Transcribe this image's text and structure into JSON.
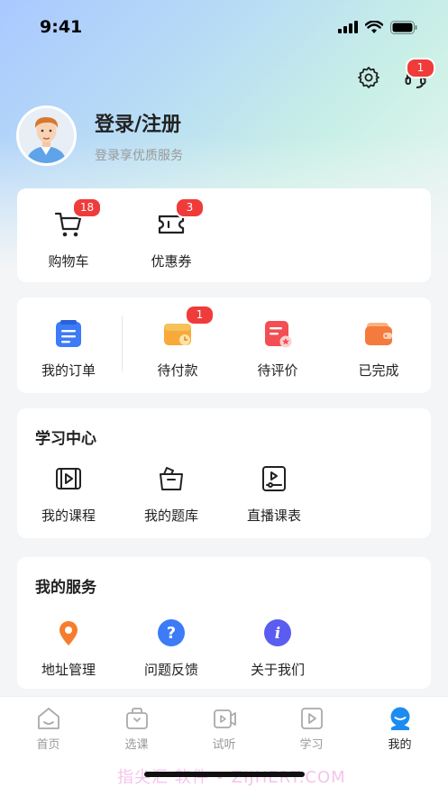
{
  "status_bar": {
    "time": "9:41"
  },
  "header": {
    "settings_icon": "gear-icon",
    "service_icon": "headset-icon",
    "service_badge": "1"
  },
  "profile": {
    "title": "登录/注册",
    "subtitle": "登录享优质服务"
  },
  "quick": [
    {
      "label": "购物车",
      "badge": "18",
      "icon": "cart-icon"
    },
    {
      "label": "优惠券",
      "badge": "3",
      "icon": "coupon-icon"
    }
  ],
  "orders": [
    {
      "label": "我的订单",
      "icon": "order-list-icon",
      "color": "#3d7bf7"
    },
    {
      "label": "待付款",
      "icon": "pending-payment-icon",
      "badge": "1",
      "color": "#f7a93a"
    },
    {
      "label": "待评价",
      "icon": "pending-review-icon",
      "color": "#f24e54"
    },
    {
      "label": "已完成",
      "icon": "completed-wallet-icon",
      "color": "#f47b3c"
    }
  ],
  "learning": {
    "title": "学习中心",
    "items": [
      {
        "label": "我的课程",
        "icon": "course-icon"
      },
      {
        "label": "我的题库",
        "icon": "question-bank-icon"
      },
      {
        "label": "直播课表",
        "icon": "live-schedule-icon"
      }
    ]
  },
  "services": {
    "title": "我的服务",
    "items": [
      {
        "label": "地址管理",
        "icon": "location-icon",
        "color": "#f57d2d"
      },
      {
        "label": "问题反馈",
        "icon": "question-icon",
        "color": "#3d7bf7"
      },
      {
        "label": "关于我们",
        "icon": "info-icon",
        "color": "#5b5cf0"
      }
    ]
  },
  "tabbar": [
    {
      "label": "首页",
      "icon": "home-icon"
    },
    {
      "label": "选课",
      "icon": "course-select-icon"
    },
    {
      "label": "试听",
      "icon": "trial-listen-icon"
    },
    {
      "label": "学习",
      "icon": "study-icon"
    },
    {
      "label": "我的",
      "icon": "mine-icon",
      "active": true
    }
  ],
  "colors": {
    "active_tab": "#1d8cf0",
    "badge": "#f03b3b"
  },
  "watermark": "指尖汇 软件 • ZIJHERT.COM"
}
